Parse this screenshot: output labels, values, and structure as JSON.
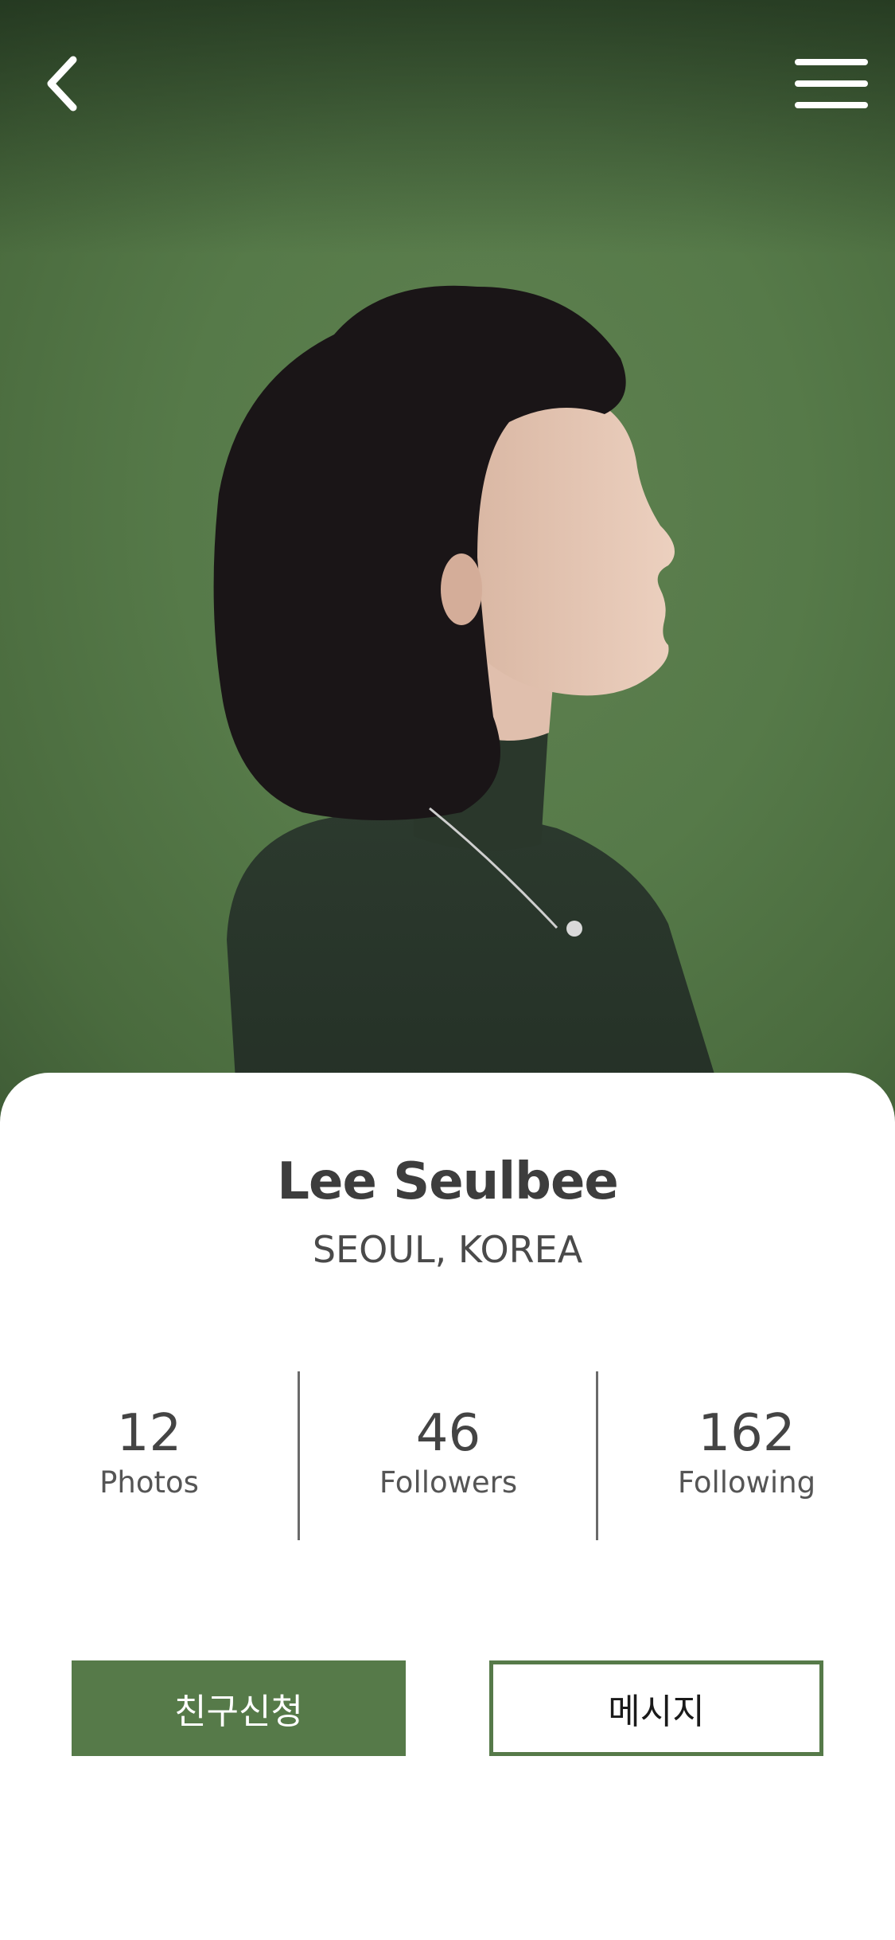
{
  "header": {
    "back_icon": "chevron-left-icon",
    "menu_icon": "hamburger-menu-icon"
  },
  "profile": {
    "name": "Lee Seulbee",
    "location": "SEOUL, KOREA"
  },
  "stats": [
    {
      "value": "12",
      "label": "Photos"
    },
    {
      "value": "46",
      "label": "Followers"
    },
    {
      "value": "162",
      "label": "Following"
    }
  ],
  "actions": {
    "friend_request_label": "친구신청",
    "message_label": "메시지"
  },
  "colors": {
    "accent": "#567a49",
    "text_dark": "#3d3d3d",
    "background": "#ffffff"
  }
}
